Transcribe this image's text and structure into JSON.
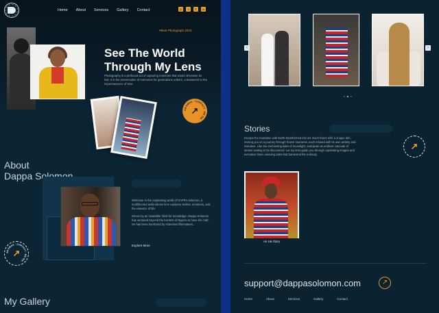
{
  "nav": {
    "items": [
      "Home",
      "About",
      "Services",
      "Gallery",
      "Contact"
    ]
  },
  "social": {
    "icons": [
      "instagram-icon",
      "facebook-icon",
      "x-icon",
      "linkedin-icon"
    ],
    "glyphs": [
      "◎",
      "f",
      "𝕏",
      "in"
    ],
    "accent": "#e89a2a"
  },
  "hero": {
    "award": "#Best Photograph 2023",
    "title_line1": "See The World",
    "title_line2": "Through My Lens",
    "description": "Photography is a profound act of capturing moments that would otherwise be lost. It is the preservation of memories for generations unborn, a testament to the impermanence of time."
  },
  "badge": {
    "text": "AN EMAIL · CONTACT · ME ON ·"
  },
  "about": {
    "title_line1": "About",
    "title_line2": "Dappa Solomon",
    "para1": "Welcome to the captivating world of DAPPA Solomon, a multifaceted artist whose lens captures stories, emotions, and the essence of life.",
    "para2": "Driven by an insatiable thirst for knowledge, Dappa Solomon has ventured beyond the borders of Nigeria to hone his craft. He has been mentored by esteemed filmmakers...",
    "explore": "Explore More"
  },
  "gallery": {
    "title": "My Gallery"
  },
  "stories": {
    "title": "Stories",
    "description": "Escape the mundane with Earth-transformed into art. Each frame tells a unique tale, inviting you on a journey through frozen moments, each infused with its own artistry and narrative. Like the enchanting tales of moonlight, anticipate an endless cascade of stories waiting to be discovered. Let my lens guide you through captivating images and evocative lines, weaving tales that transcend the ordinary.",
    "card_caption": "An Ha Story"
  },
  "footer": {
    "email": "support@dappasolomon.com",
    "nav": [
      "Home",
      "About",
      "Services",
      "Gallery",
      "Contact"
    ]
  },
  "colors": {
    "accent": "#e8932a",
    "background": "#0b2231",
    "divider": "#0e2f8a"
  }
}
